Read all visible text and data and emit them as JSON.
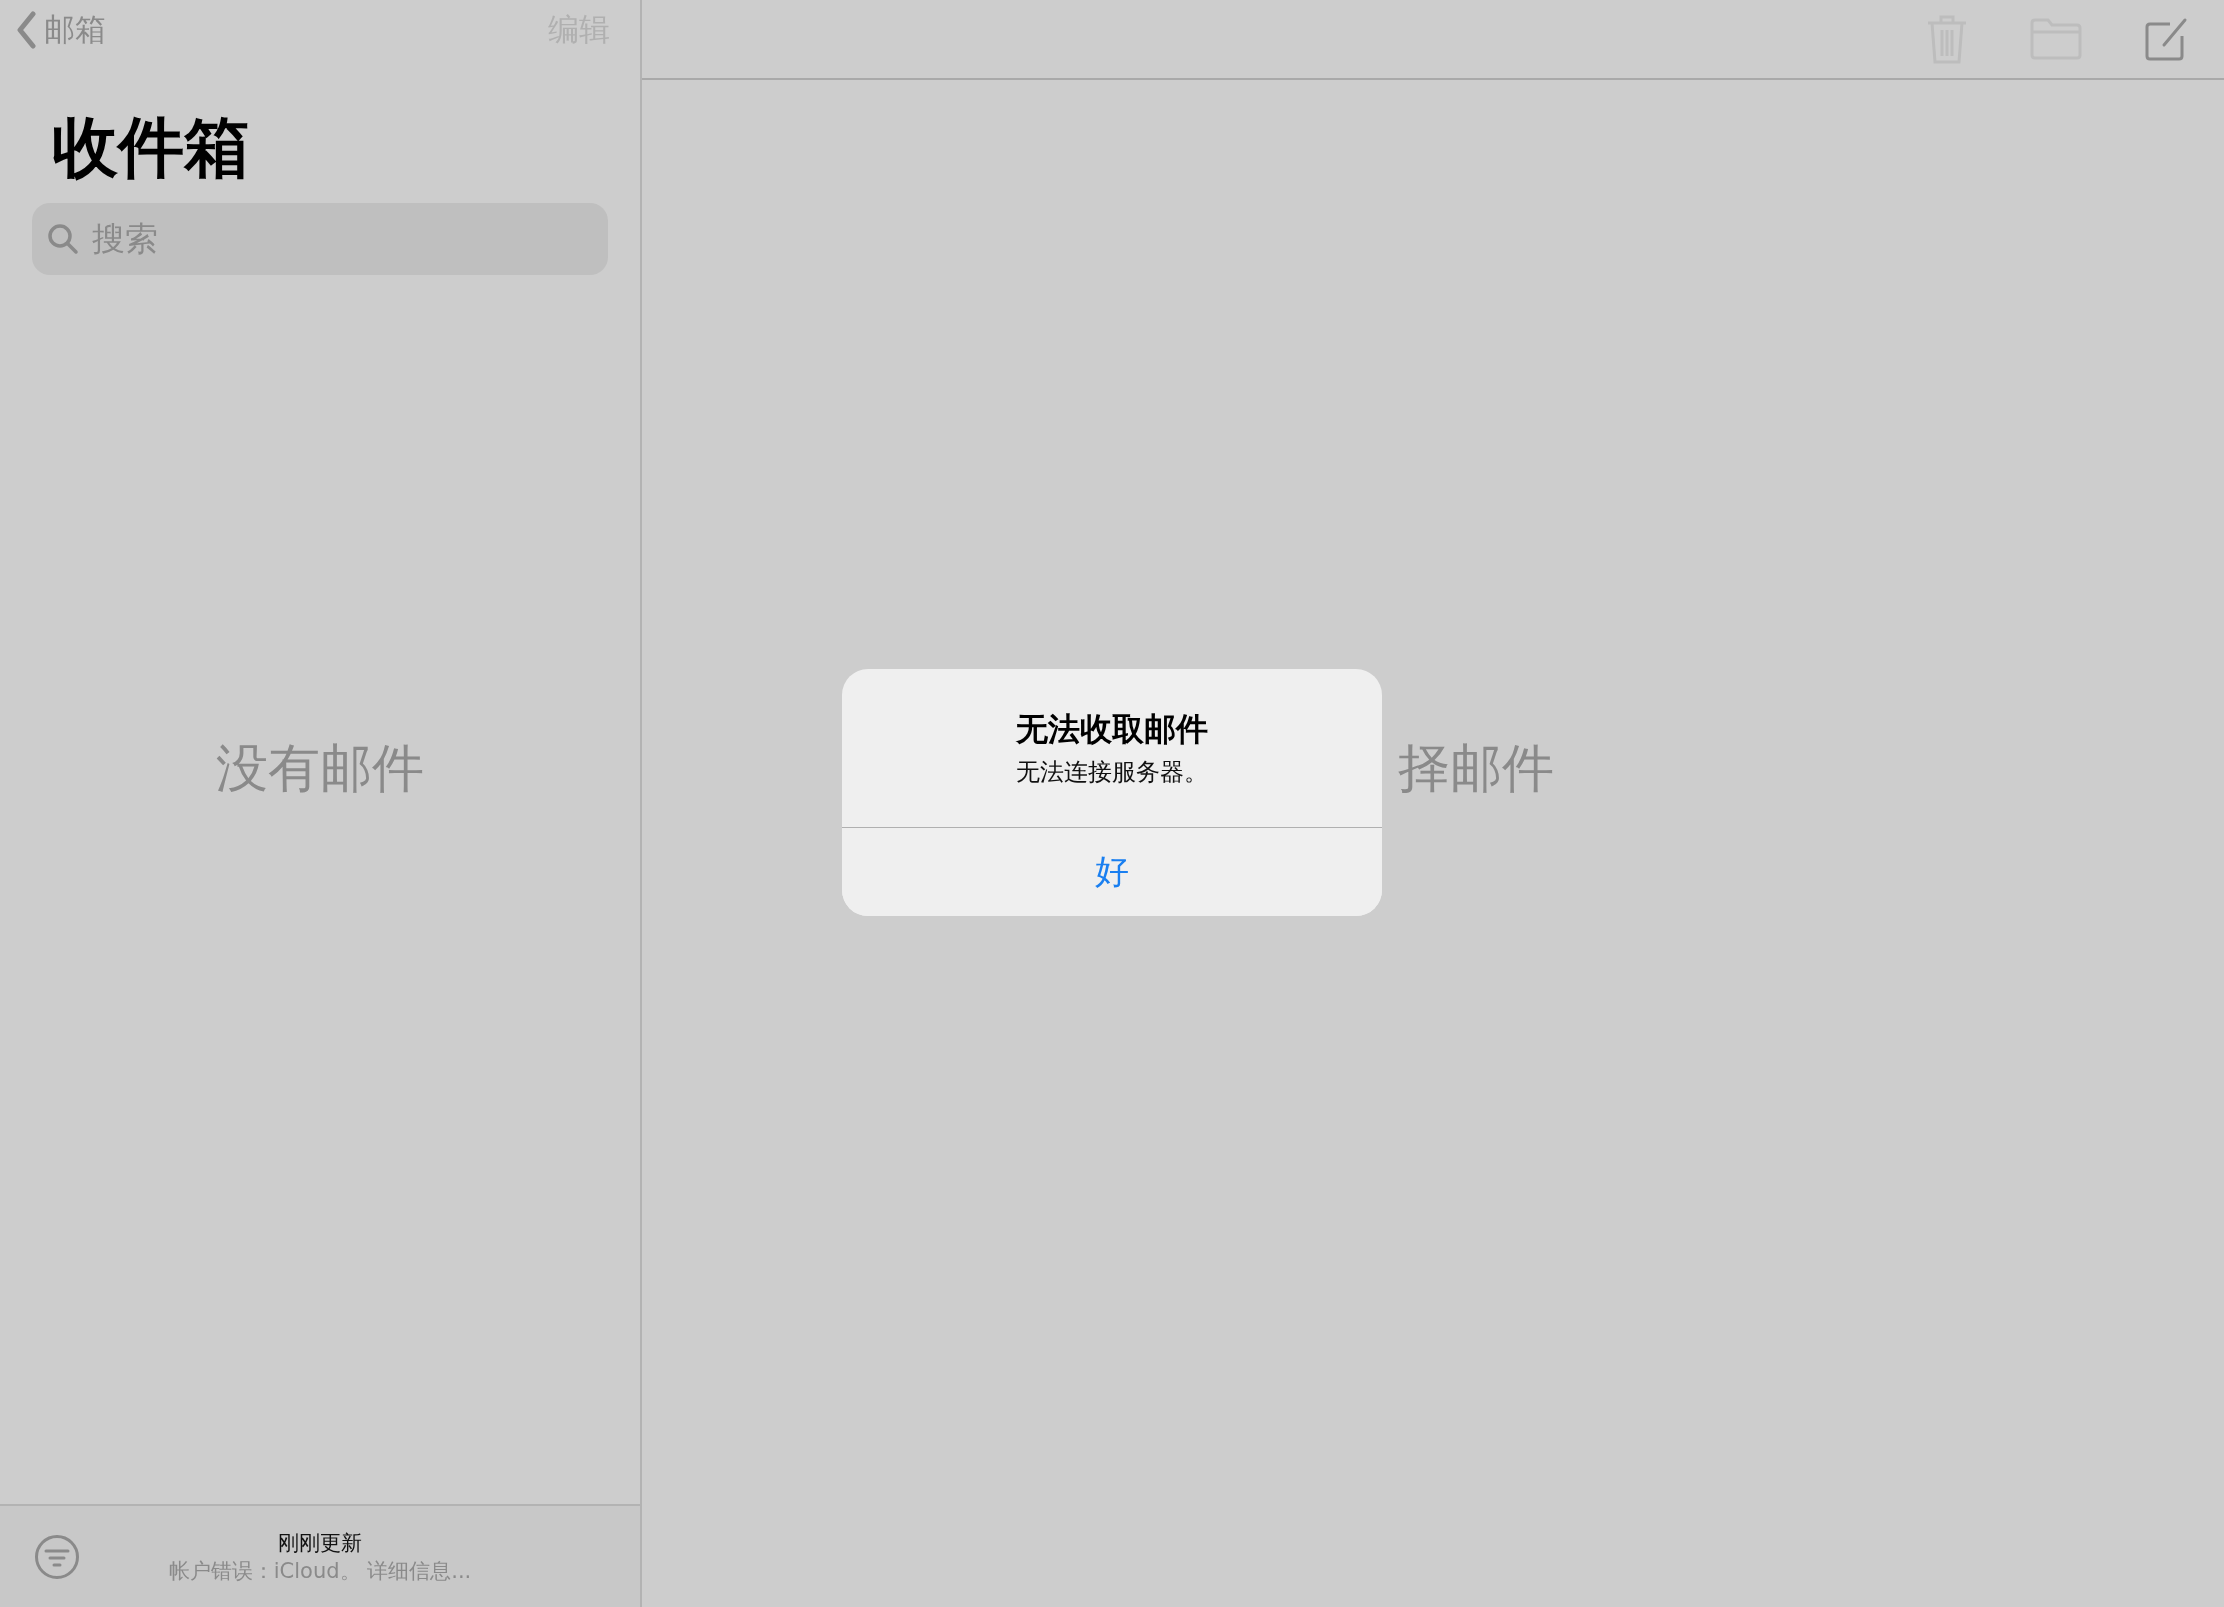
{
  "sidebar": {
    "back_button": "邮箱",
    "edit_button": "编辑",
    "title": "收件箱",
    "search": {
      "placeholder": "搜索"
    },
    "empty_message": "没有邮件",
    "status": {
      "title": "刚刚更新",
      "detail": "帐户错误：iCloud。 详细信息..."
    }
  },
  "toolbar": [
    {
      "kind": "trash",
      "disabled": true
    },
    {
      "kind": "folder",
      "disabled": true
    },
    {
      "kind": "compose",
      "disabled": false
    }
  ],
  "detail": {
    "empty_message": "择邮件"
  },
  "alert": {
    "title": "无法收取邮件",
    "message": "无法连接服务器。",
    "buttons": [
      "好"
    ]
  }
}
